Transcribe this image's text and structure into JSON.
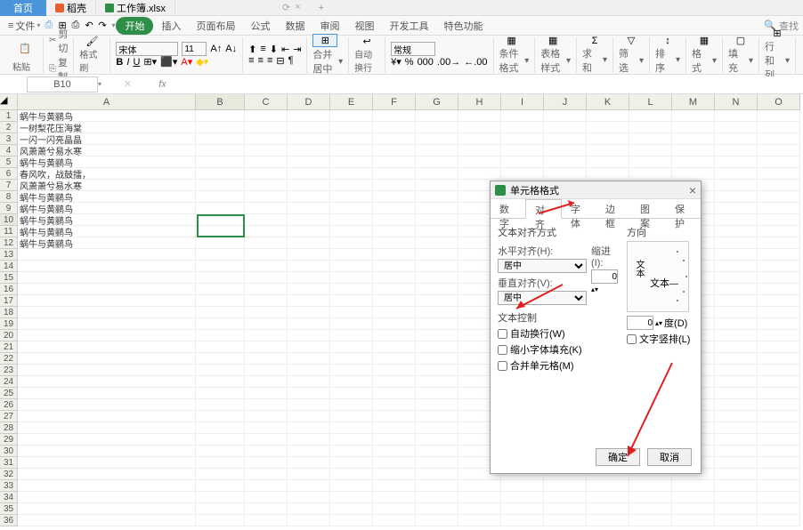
{
  "tabs": {
    "home": "首页",
    "shell": "稻壳",
    "workbook": "工作簿.xlsx"
  },
  "menu": {
    "file": "文件",
    "start": "开始",
    "insert": "插入",
    "pagelayout": "页面布局",
    "formulas": "公式",
    "data": "数据",
    "review": "审阅",
    "view": "视图",
    "devtools": "开发工具",
    "special": "特色功能",
    "search": "查找"
  },
  "ribbon": {
    "cut": "剪切",
    "copy": "复制",
    "format_painter": "格式刷",
    "paste": "粘贴",
    "font_name": "宋体",
    "font_size": "11",
    "number_format": "常规",
    "merge": "合并居中",
    "wrap": "自动换行",
    "cond_format": "条件格式",
    "table_style": "表格样式",
    "sum": "求和",
    "filter": "筛选",
    "sort": "排序",
    "format": "格式",
    "fill": "填充",
    "rowcol": "行和列"
  },
  "name_box": "B10",
  "columns": [
    "A",
    "B",
    "C",
    "D",
    "E",
    "F",
    "G",
    "H",
    "I",
    "J",
    "K",
    "L",
    "M",
    "N",
    "O"
  ],
  "rows": [
    "蜗牛与黄鹂鸟",
    "一树梨花压海棠",
    "一闪一闪亮晶晶",
    "风萧萧兮易水寒",
    "蜗牛与黄鹂鸟",
    "春风吹，战鼓擂，",
    "风萧萧兮易水寒",
    "蜗牛与黄鹂鸟",
    "蜗牛与黄鹂鸟",
    "蜗牛与黄鹂鸟",
    "蜗牛与黄鹂鸟",
    "蜗牛与黄鹂鸟"
  ],
  "dialog": {
    "title": "单元格格式",
    "tabs": {
      "number": "数字",
      "alignment": "对齐",
      "font": "字体",
      "border": "边框",
      "pattern": "图案",
      "protection": "保护"
    },
    "text_align": "文本对齐方式",
    "h_align": "水平对齐(H):",
    "h_align_val": "居中",
    "v_align": "垂直对齐(V):",
    "v_align_val": "居中",
    "indent": "缩进(I):",
    "indent_val": "0",
    "text_control": "文本控制",
    "wrap_text": "自动换行(W)",
    "shrink_fit": "缩小字体填充(K)",
    "merge_cells": "合并单元格(M)",
    "orientation": "方向",
    "text_v": "文本",
    "text_h": "文本",
    "degree": "度(D)",
    "degree_val": "0",
    "vertical_text": "文字竖排(L)",
    "ok": "确定",
    "cancel": "取消"
  },
  "chart_data": null
}
